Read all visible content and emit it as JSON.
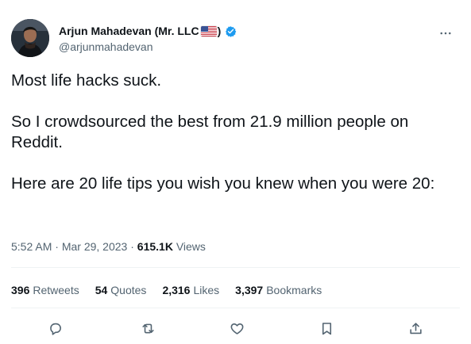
{
  "author": {
    "display_name": "Arjun Mahadevan (Mr. LLC",
    "close_paren": ")",
    "handle": "@arjunmahadevan",
    "avatar_icon": "person-photo-avatar",
    "flag_icon": "us-flag-icon",
    "verified_icon": "verified-badge-icon"
  },
  "tweet": {
    "paragraphs": [
      "Most life hacks suck.",
      "So I crowdsourced the best from 21.9 million people on Reddit.",
      "Here are 20 life tips you wish you knew when you were 20:"
    ]
  },
  "meta": {
    "time": "5:52 AM",
    "dot1": "·",
    "date": "Mar 29, 2023",
    "dot2": "·",
    "views_count": "615.1K",
    "views_label": "Views"
  },
  "stats": [
    {
      "count": "396",
      "label": "Retweets"
    },
    {
      "count": "54",
      "label": "Quotes"
    },
    {
      "count": "2,316",
      "label": "Likes"
    },
    {
      "count": "3,397",
      "label": "Bookmarks"
    }
  ],
  "actions": {
    "reply_icon": "reply-icon",
    "retweet_icon": "retweet-icon",
    "like_icon": "heart-icon",
    "bookmark_icon": "bookmark-icon",
    "share_icon": "share-icon"
  },
  "colors": {
    "text": "#0f1419",
    "secondary": "#536471",
    "verified": "#1d9bf0",
    "divider": "#eff3f4"
  }
}
